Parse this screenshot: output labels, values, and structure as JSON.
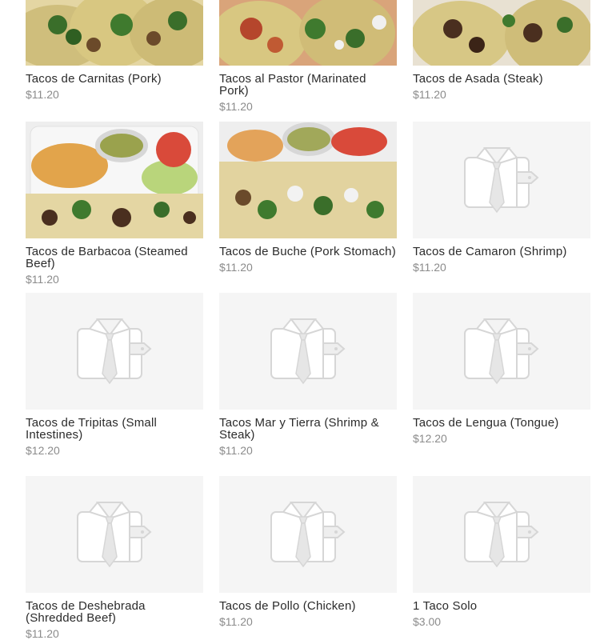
{
  "products": [
    {
      "name": "Tacos de Carnitas (Pork)",
      "price": "$11.20",
      "image": "photo-tacos-carnitas"
    },
    {
      "name": "Tacos al Pastor (Marinated Pork)",
      "price": "$11.20",
      "image": "photo-tacos-al-pastor"
    },
    {
      "name": "Tacos de Asada (Steak)",
      "price": "$11.20",
      "image": "photo-tacos-asada"
    },
    {
      "name": "Tacos de Barbacoa (Steamed Beef)",
      "price": "$11.20",
      "image": "photo-tacos-barbacoa-plate"
    },
    {
      "name": "Tacos de Buche (Pork Stomach)",
      "price": "$11.20",
      "image": "photo-tacos-buche-plate"
    },
    {
      "name": "Tacos de Camaron (Shrimp)",
      "price": "$11.20",
      "image": "placeholder-shirt-icon"
    },
    {
      "name": "Tacos de Tripitas (Small Intestines)",
      "price": "$12.20",
      "image": "placeholder-shirt-icon"
    },
    {
      "name": "Tacos Mar y Tierra (Shrimp & Steak)",
      "price": "$11.20",
      "image": "placeholder-shirt-icon"
    },
    {
      "name": "Tacos de Lengua (Tongue)",
      "price": "$12.20",
      "image": "placeholder-shirt-icon"
    },
    {
      "name": "Tacos de Deshebrada (Shredded Beef)",
      "price": "$11.20",
      "image": "placeholder-shirt-icon"
    },
    {
      "name": "Tacos de Pollo (Chicken)",
      "price": "$11.20",
      "image": "placeholder-shirt-icon"
    },
    {
      "name": "1 Taco Solo",
      "price": "$3.00",
      "image": "placeholder-shirt-icon"
    }
  ],
  "colors": {
    "name_text": "#2b2b2b",
    "price_text": "#8b8b8b",
    "placeholder_bg": "#f5f5f5",
    "placeholder_icon": "#d9d9d9"
  }
}
